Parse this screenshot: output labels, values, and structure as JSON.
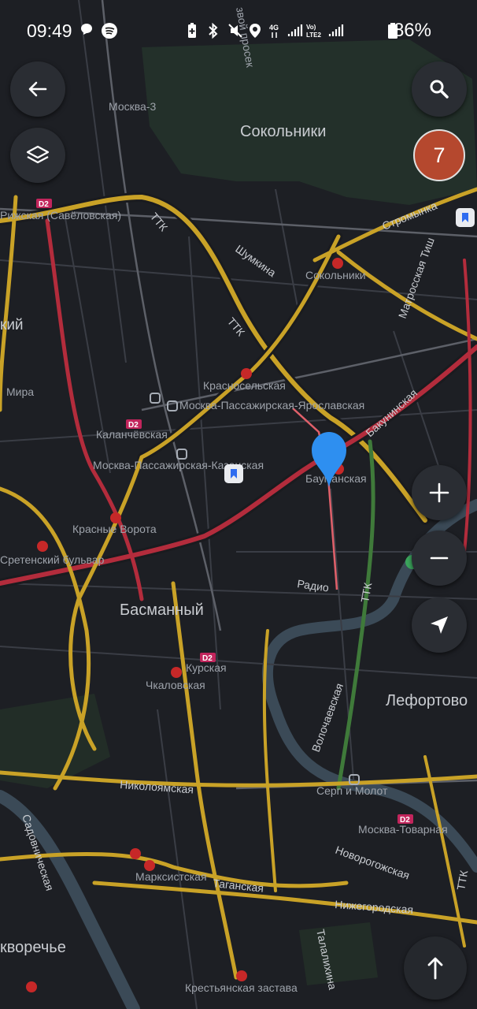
{
  "status_bar": {
    "time": "09:49",
    "battery": "86%",
    "icons": [
      "chat-bubble-icon",
      "spotify-icon",
      "battery-saver-icon",
      "bluetooth-icon",
      "mute-icon",
      "location-icon",
      "4g-icon",
      "signal-icon",
      "volte2-icon",
      "signal-2-icon",
      "battery-icon"
    ]
  },
  "controls": {
    "back": "arrow-left-icon",
    "layers": "layers-icon",
    "search": "search-icon",
    "notifications_count": "7",
    "zoom_in": "plus-icon",
    "zoom_out": "minus-icon",
    "locate": "navigation-arrow-icon",
    "route": "arrow-up-icon"
  },
  "labels": {
    "sokolniki": "Сокольники",
    "moskva3": "Москва-3",
    "prosek": "звой просек",
    "ttk1": "ТТК",
    "ttk2": "ТТК",
    "ttk3": "ТТК",
    "ttk4": "ТТК",
    "shumkina": "Шумкина",
    "sokolniki_st": "Сокольники",
    "stromynka": "Стромынка",
    "matrosskaya": "Матросская Тиш",
    "rizhskaya": "Рижская (Савёловская)",
    "kiy": "кий",
    "mira": "Мира",
    "krasnoselskaya": "Красносельская",
    "mp_yaroslavskaya": "Москва-Пассажирская-Ярославская",
    "kalanchevskaya": "Каланчёвская",
    "mp_kazanskaya": "Москва-Пассажирская-Казанская",
    "bakuninskaya": "Бакунинская",
    "baumanskaya": "Бауманская",
    "krasnye_vorota": "Красные Ворота",
    "sretensky": "Сретенский бульвар",
    "radio": "Радио",
    "basmanny": "Басманный",
    "kurskaya": "Курская",
    "chkalovskaya": "Чкаловская",
    "volochaevskaya": "Волочаевская",
    "lefortovo": "Лефортово",
    "nikoloyamskaya": "Николоямская",
    "serp_molot": "Серп и Молот",
    "moskva_tovarnaya": "Москва-Товарная",
    "sadovnicheskaya": "Садовническая",
    "marksistskaya": "Марксистская",
    "taganskaya": "Таганская",
    "novorogozhskaya": "Новорогожская",
    "nizhegorodskaya": "Нижегородская",
    "talalikhina": "Талалихина",
    "zamoskvorechye": "кворечье",
    "krestyanskaya": "Крестьянская застава",
    "d2_1": "D2",
    "d2_2": "D2",
    "d2_3": "D2",
    "d2_4": "D2",
    "metro": "М"
  },
  "colors": {
    "background": "#1d1f24",
    "road_jam": "#b32c3c",
    "road_medium": "#c9a227",
    "road_free": "#3f7a3a",
    "park": "#23332a",
    "water": "#3e4f5c",
    "route": "#e0606a",
    "pin": "#2e8ff0"
  }
}
